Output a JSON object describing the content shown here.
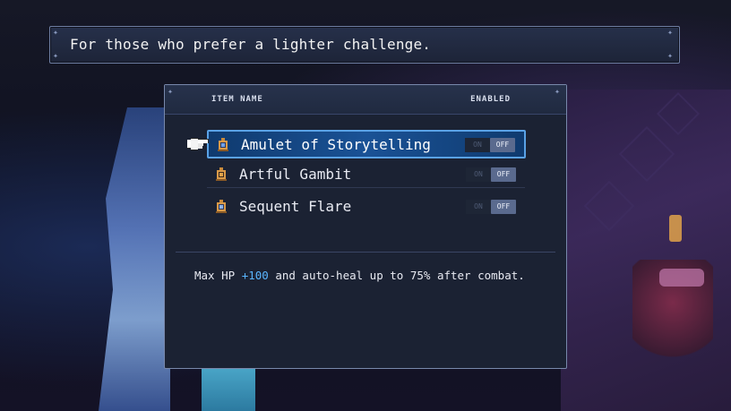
{
  "hint": {
    "text": "For those who prefer a lighter challenge."
  },
  "panel": {
    "headers": {
      "item_name": "ITEM NAME",
      "enabled": "ENABLED"
    },
    "items": [
      {
        "label": "Amulet of Storytelling",
        "icon": "amulet-icon",
        "on_label": "ON",
        "off_label": "OFF",
        "state": "off",
        "selected": true
      },
      {
        "label": "Artful Gambit",
        "icon": "amulet-icon",
        "on_label": "ON",
        "off_label": "OFF",
        "state": "off",
        "selected": false
      },
      {
        "label": "Sequent Flare",
        "icon": "amulet-icon",
        "on_label": "ON",
        "off_label": "OFF",
        "state": "off",
        "selected": false
      }
    ],
    "description": {
      "prefix": "Max HP ",
      "highlight": "+100",
      "suffix": " and auto-heal up to 75% after combat."
    }
  },
  "colors": {
    "selection_border": "#5aa2e6",
    "highlight_value": "#5ab5ff",
    "panel_bg": "#1b2233"
  },
  "cursor": {
    "icon": "pointing-hand-icon"
  }
}
